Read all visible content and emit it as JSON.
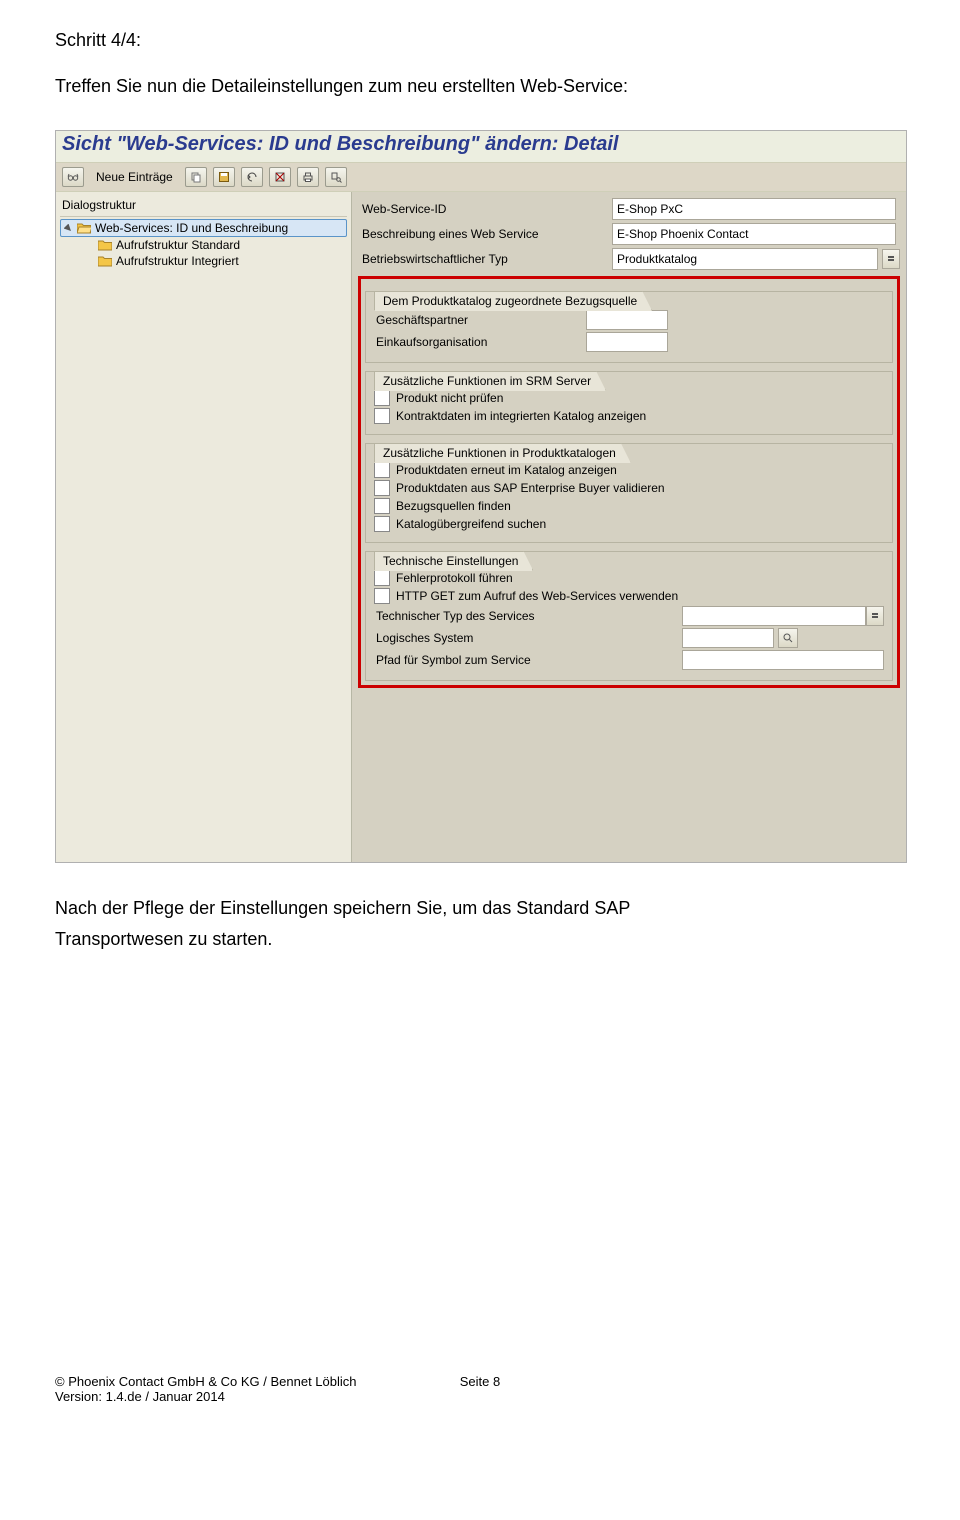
{
  "doc": {
    "step_heading": "Schritt 4/4:",
    "intro": "Treffen Sie nun die Detaileinstellungen zum neu erstellten Web-Service:",
    "outro1": "Nach der Pflege der Einstellungen speichern Sie, um das Standard SAP",
    "outro2": "Transportwesen zu starten."
  },
  "sap": {
    "title": "Sicht \"Web-Services: ID und Beschreibung\" ändern: Detail",
    "toolbar": {
      "neue_eintraege": "Neue Einträge"
    },
    "tree": {
      "header": "Dialogstruktur",
      "root": "Web-Services: ID und Beschreibung",
      "child1": "Aufrufstruktur Standard",
      "child2": "Aufrufstruktur Integriert"
    },
    "header_fields": {
      "id_label": "Web-Service-ID",
      "id_value": "E-Shop PxC",
      "desc_label": "Beschreibung eines Web Service",
      "desc_value": "E-Shop Phoenix Contact",
      "typ_label": "Betriebswirtschaftlicher Typ",
      "typ_value": "Produktkatalog"
    },
    "group1": {
      "title": "Dem Produktkatalog zugeordnete Bezugsquelle",
      "row1": "Geschäftspartner",
      "row2": "Einkaufsorganisation"
    },
    "group2": {
      "title": "Zusätzliche Funktionen im SRM Server",
      "opt1": "Produkt nicht prüfen",
      "opt2": "Kontraktdaten im integrierten Katalog anzeigen"
    },
    "group3": {
      "title": "Zusätzliche Funktionen in Produktkatalogen",
      "opt1": "Produktdaten erneut im Katalog anzeigen",
      "opt2": "Produktdaten aus SAP Enterprise Buyer validieren",
      "opt3": "Bezugsquellen finden",
      "opt4": "Katalogübergreifend suchen"
    },
    "group4": {
      "title": "Technische Einstellungen",
      "opt1": "Fehlerprotokoll führen",
      "opt2": "HTTP GET zum Aufruf des Web-Services verwenden",
      "row1": "Technischer Typ des Services",
      "row2": "Logisches System",
      "row3": "Pfad für Symbol zum Service"
    }
  },
  "footer": {
    "copyright": "© Phoenix Contact GmbH & Co KG / Bennet Löblich",
    "version": "Version: 1.4.de / Januar 2014",
    "page": "Seite 8"
  }
}
